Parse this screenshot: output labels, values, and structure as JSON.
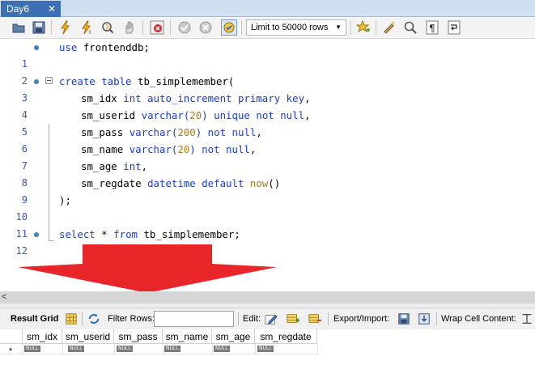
{
  "tab": {
    "title": "Day6",
    "close": "✕"
  },
  "toolbar": {
    "limit_value": "Limit to 50000 rows",
    "icons": [
      "open-folder-icon",
      "save-icon",
      "execute-icon",
      "execute-current-icon",
      "explain-icon",
      "stop-icon",
      "toggle-error-icon",
      "commit-icon",
      "rollback-icon",
      "autocommit-icon",
      "bookmark-star-icon",
      "beautify-icon",
      "find-icon",
      "invisible-chars-icon",
      "wrap-icon"
    ]
  },
  "editor": {
    "line_numbers": [
      "1",
      "2",
      "3",
      "4",
      "5",
      "6",
      "7",
      "8",
      "9",
      "10",
      "11",
      "12"
    ],
    "lines": {
      "l1": {
        "kw": "use",
        "rest": " frontenddb;"
      },
      "l3": {
        "kw": "create table",
        "rest": " tb_simplemember("
      },
      "l4": {
        "name": "sm_idx",
        "kw": "int auto_increment primary key",
        "end": ","
      },
      "l5": {
        "name": "sm_userid",
        "kw1": "varchar(",
        "num": "20",
        "kw2": ") unique not null",
        "end": ","
      },
      "l6": {
        "name": "sm_pass",
        "kw1": "varchar(",
        "num": "200",
        "kw2": ") not null",
        "end": ","
      },
      "l7": {
        "name": "sm_name",
        "kw1": "varchar(",
        "num": "20",
        "kw2": ") not null",
        "end": ","
      },
      "l8": {
        "name": "sm_age",
        "kw": "int",
        "end": ","
      },
      "l9": {
        "name": "sm_regdate",
        "kw": "datetime default",
        "fn": "now",
        "end": "()"
      },
      "l10": {
        "text": ");"
      },
      "l12": {
        "kw1": "select",
        "mid": " * ",
        "kw2": "from",
        "rest": " tb_simplemember;"
      }
    }
  },
  "result_toolbar": {
    "result_grid": "Result Grid",
    "filter_rows": "Filter Rows:",
    "filter_value": "",
    "edit": "Edit:",
    "export_import": "Export/Import:",
    "wrap": "Wrap Cell Content:"
  },
  "grid": {
    "columns": [
      "sm_idx",
      "sm_userid",
      "sm_pass",
      "sm_name",
      "sm_age",
      "sm_regdate"
    ],
    "null_label": "NULL",
    "new_row_marker": "*"
  },
  "colors": {
    "tab_active": "#3d6fb4",
    "keyword": "#1a3ccf",
    "number": "#b07a20",
    "arrow": "#e8262a"
  }
}
